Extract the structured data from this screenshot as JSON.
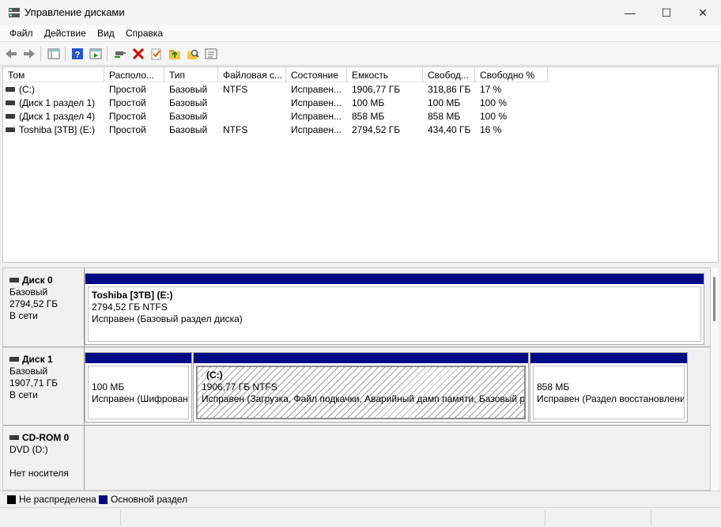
{
  "window": {
    "title": "Управление дисками",
    "controls": {
      "minimize": "—",
      "maximize": "☐",
      "close": "✕"
    }
  },
  "menu": [
    "Файл",
    "Действие",
    "Вид",
    "Справка"
  ],
  "toolbar_icons": [
    "back-arrow-icon",
    "forward-arrow-icon",
    "console-tree-icon",
    "help-icon",
    "properties-icon",
    "connect-icon",
    "delete-icon",
    "check-icon",
    "folder-up-icon",
    "search-folder-icon",
    "list-icon"
  ],
  "volume_table": {
    "columns": [
      "Том",
      "Располо...",
      "Тип",
      "Файловая с...",
      "Состояние",
      "Емкость",
      "Свобод...",
      "Свободно %"
    ],
    "rows": [
      [
        "(C:)",
        "Простой",
        "Базовый",
        "NTFS",
        "Исправен...",
        "1906,77 ГБ",
        "318,86 ГБ",
        "17 %"
      ],
      [
        "(Диск 1 раздел 1)",
        "Простой",
        "Базовый",
        "",
        "Исправен...",
        "100 МБ",
        "100 МБ",
        "100 %"
      ],
      [
        "(Диск 1 раздел 4)",
        "Простой",
        "Базовый",
        "",
        "Исправен...",
        "858 МБ",
        "858 МБ",
        "100 %"
      ],
      [
        "Toshiba [3TB] (E:)",
        "Простой",
        "Базовый",
        "NTFS",
        "Исправен...",
        "2794,52 ГБ",
        "434,40 ГБ",
        "16 %"
      ]
    ]
  },
  "disks": [
    {
      "name": "Диск 0",
      "type": "Базовый",
      "size": "2794,52 ГБ",
      "status": "В сети",
      "partitions": [
        {
          "title": "Toshiba [3TB]  (E:)",
          "detail": "2794,52 ГБ NTFS",
          "status": "Исправен (Базовый раздел диска)"
        }
      ]
    },
    {
      "name": "Диск 1",
      "type": "Базовый",
      "size": "1907,71 ГБ",
      "status": "В сети",
      "partitions": [
        {
          "title": "",
          "detail": "100 МБ",
          "status": "Исправен (Шифрован"
        },
        {
          "title": "(C:)",
          "detail": "1906,77 ГБ NTFS",
          "status": "Исправен (Загрузка, Файл подкачки, Аварийный дамп памяти, Базовый ра"
        },
        {
          "title": "",
          "detail": "858 МБ",
          "status": "Исправен (Раздел восстановлени"
        }
      ]
    },
    {
      "name": "CD-ROM 0",
      "type": "DVD (D:)",
      "size": "",
      "status": "Нет носителя"
    }
  ],
  "legend": [
    {
      "label": "Не распределена",
      "color": "#000000"
    },
    {
      "label": "Основной раздел",
      "color": "#000a85"
    }
  ]
}
